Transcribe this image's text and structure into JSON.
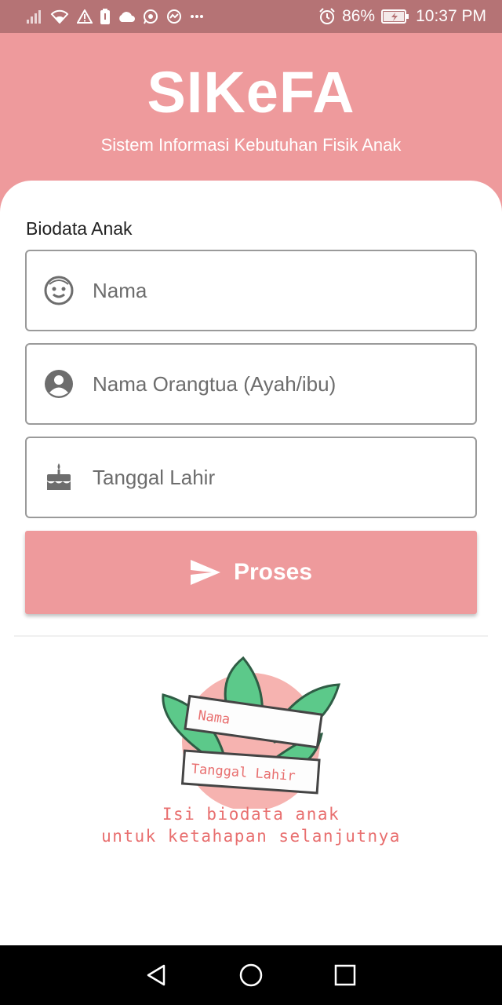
{
  "status_bar": {
    "battery": "86%",
    "time": "10:37 PM",
    "icons": [
      "signal-icon",
      "wifi-icon",
      "warning-icon",
      "battery-saver-icon",
      "cloud-icon",
      "whatsapp-icon",
      "messenger-icon",
      "more-dots-icon",
      "alarm-icon",
      "battery-icon"
    ]
  },
  "header": {
    "title": "SIKeFA",
    "subtitle": "Sistem Informasi Kebutuhan Fisik Anak"
  },
  "form": {
    "section_label": "Biodata Anak",
    "fields": [
      {
        "placeholder": "Nama",
        "icon": "face-icon"
      },
      {
        "placeholder": "Nama Orangtua (Ayah/ibu)",
        "icon": "account-circle-icon"
      },
      {
        "placeholder": "Tanggal Lahir",
        "icon": "cake-icon"
      }
    ],
    "submit_label": "Proses",
    "submit_icon": "send-icon"
  },
  "illustration": {
    "card_labels": [
      "Nama",
      "Tanggal Lahir"
    ],
    "caption_line1": "Isi biodata anak",
    "caption_line2": "untuk ketahapan selanjutnya"
  },
  "colors": {
    "primary": "#ee9a9c",
    "status_bar": "#b57375",
    "accent_text": "#e86f6f",
    "leaf": "#5cc98a"
  },
  "navbar": {
    "buttons": [
      "back-icon",
      "home-icon",
      "recents-icon"
    ]
  }
}
